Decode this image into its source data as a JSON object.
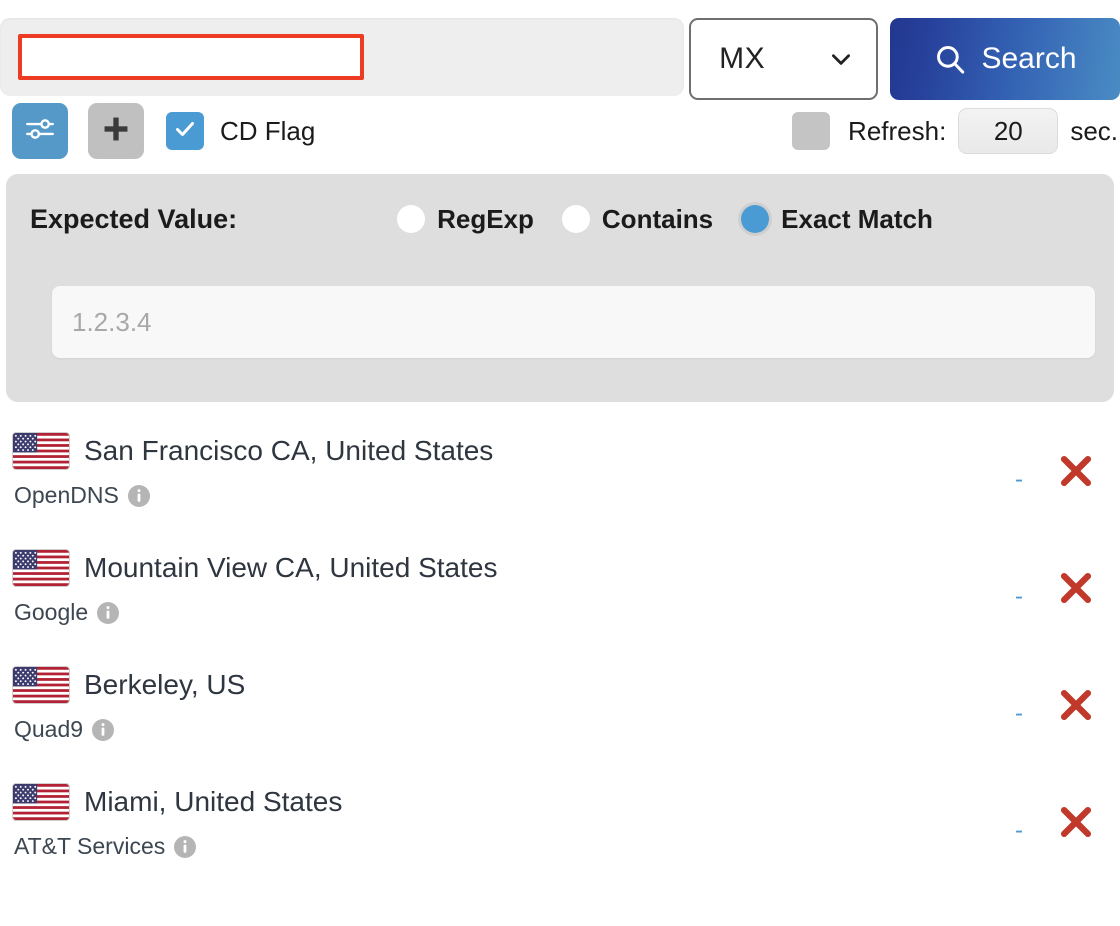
{
  "search": {
    "query_value": "",
    "query_placeholder": "",
    "record_type": "MX",
    "search_label": "Search",
    "search_icon": "magnifier-icon",
    "chevron_icon": "chevron-down-icon"
  },
  "toolbar": {
    "filter_icon": "sliders-icon",
    "add_icon": "plus-icon",
    "cd_flag_label": "CD Flag",
    "cd_flag_checked": true,
    "refresh_checked": false,
    "refresh_label": "Refresh:",
    "refresh_seconds": "20",
    "seconds_unit": "sec."
  },
  "expected_value": {
    "title": "Expected Value:",
    "options": [
      {
        "label": "RegExp",
        "selected": false
      },
      {
        "label": "Contains",
        "selected": false
      },
      {
        "label": "Exact Match",
        "selected": true
      }
    ],
    "input_value": "",
    "input_placeholder": "1.2.3.4"
  },
  "results": {
    "dash_label": "-",
    "delete_icon": "close-x-icon",
    "info_icon": "info-icon",
    "flag_icon": "us-flag-icon",
    "rows": [
      {
        "location": "San Francisco CA, United States",
        "provider": "OpenDNS"
      },
      {
        "location": "Mountain View CA, United States",
        "provider": "Google"
      },
      {
        "location": "Berkeley, US",
        "provider": "Quad9"
      },
      {
        "location": "Miami, United States",
        "provider": "AT&T Services"
      }
    ]
  },
  "colors": {
    "accent_blue": "#4a9ad4",
    "search_gradient_start": "#22378f",
    "search_gradient_end": "#4a8cc4",
    "input_outline_red": "#ee3b24",
    "delete_red": "#c0392b",
    "panel_grey": "#dedede"
  }
}
